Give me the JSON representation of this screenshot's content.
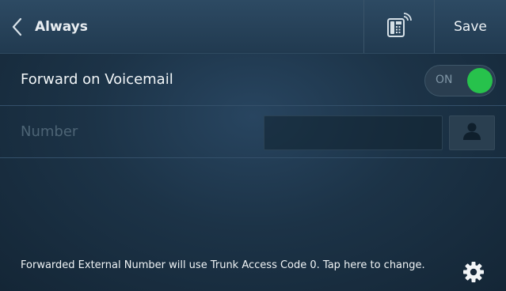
{
  "header": {
    "back_title": "Always",
    "save_label": "Save",
    "phone_icon": "desk-phone-wireless-icon"
  },
  "voicemail_row": {
    "label": "Forward on Voicemail",
    "toggle_text": "ON",
    "toggle_on": true,
    "toggle_color": "#27c24c"
  },
  "number_row": {
    "label": "Number",
    "value": "",
    "contact_icon": "person-icon"
  },
  "footer": {
    "message": "Forwarded External Number will use Trunk Access Code 0. Tap here to change.",
    "settings_icon": "gear-icon"
  }
}
